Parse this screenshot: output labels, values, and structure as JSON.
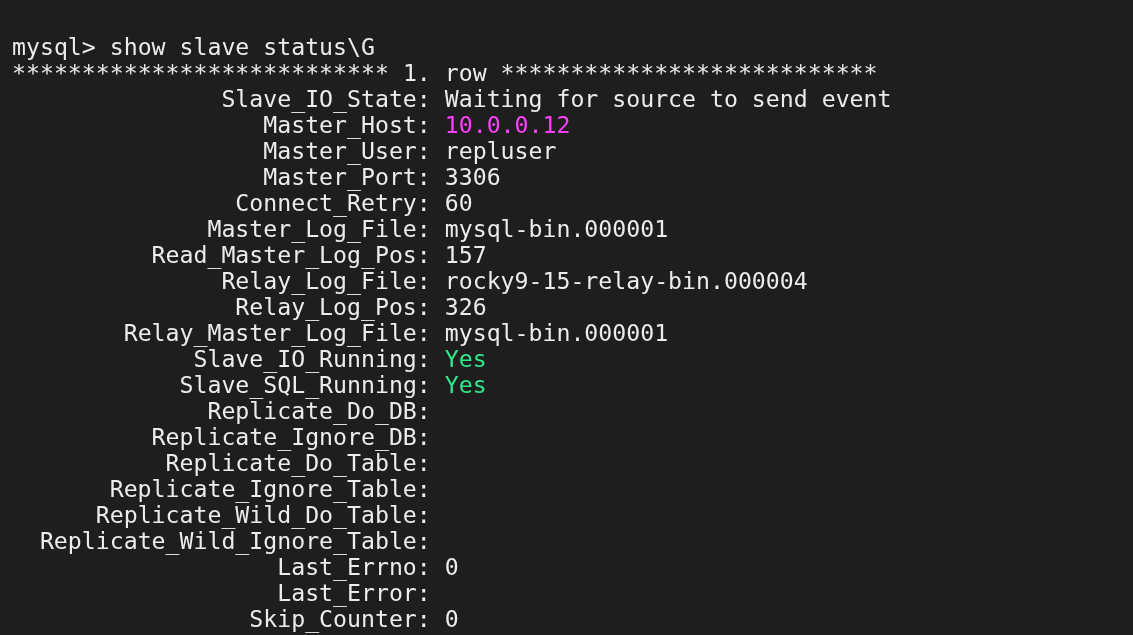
{
  "terminal": {
    "command_line": "mysql> show slave status\\G",
    "row_header": "*************************** 1. row ***************************",
    "fields": [
      {
        "label": "Slave_IO_State:",
        "value": "Waiting for source to send event"
      },
      {
        "label": "Master_Host:",
        "value": "10.0.0.12",
        "color": "#ff40ff"
      },
      {
        "label": "Master_User:",
        "value": "repluser"
      },
      {
        "label": "Master_Port:",
        "value": "3306"
      },
      {
        "label": "Connect_Retry:",
        "value": "60"
      },
      {
        "label": "Master_Log_File:",
        "value": "mysql-bin.000001"
      },
      {
        "label": "Read_Master_Log_Pos:",
        "value": "157"
      },
      {
        "label": "Relay_Log_File:",
        "value": "rocky9-15-relay-bin.000004"
      },
      {
        "label": "Relay_Log_Pos:",
        "value": "326"
      },
      {
        "label": "Relay_Master_Log_File:",
        "value": "mysql-bin.000001"
      },
      {
        "label": "Slave_IO_Running:",
        "value": "Yes",
        "color": "#2ee88a"
      },
      {
        "label": "Slave_SQL_Running:",
        "value": "Yes",
        "color": "#2ee88a"
      },
      {
        "label": "Replicate_Do_DB:"
      },
      {
        "label": "Replicate_Ignore_DB:"
      },
      {
        "label": "Replicate_Do_Table:"
      },
      {
        "label": "Replicate_Ignore_Table:"
      },
      {
        "label": "Replicate_Wild_Do_Table:"
      },
      {
        "label": "Replicate_Wild_Ignore_Table:"
      },
      {
        "label": "Last_Errno:",
        "value": "0"
      },
      {
        "label": "Last_Error:"
      },
      {
        "label": "Skip_Counter:",
        "value": "0"
      }
    ]
  }
}
